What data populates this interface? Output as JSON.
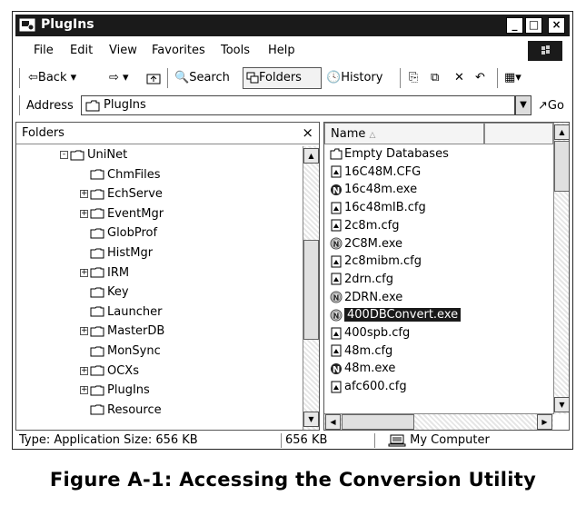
{
  "window": {
    "title": "PlugIns"
  },
  "title_buttons": {
    "minimize": "_",
    "maximize": "□",
    "close": "×"
  },
  "menu": [
    "File",
    "Edit",
    "View",
    "Favorites",
    "Tools",
    "Help"
  ],
  "toolbar": {
    "back": "Back",
    "search": "Search",
    "folders": "Folders",
    "history": "History"
  },
  "address": {
    "label": "Address",
    "value": "PlugIns",
    "go": "Go"
  },
  "folders_pane": {
    "header": "Folders",
    "close": "×",
    "items": [
      {
        "label": "UniNet",
        "expander": "-"
      },
      {
        "label": "ChmFiles",
        "expander": ""
      },
      {
        "label": "EchServe",
        "expander": "+"
      },
      {
        "label": "EventMgr",
        "expander": "+"
      },
      {
        "label": "GlobProf",
        "expander": ""
      },
      {
        "label": "HistMgr",
        "expander": ""
      },
      {
        "label": "IRM",
        "expander": "+"
      },
      {
        "label": "Key",
        "expander": ""
      },
      {
        "label": "Launcher",
        "expander": ""
      },
      {
        "label": "MasterDB",
        "expander": "+"
      },
      {
        "label": "MonSync",
        "expander": ""
      },
      {
        "label": "OCXs",
        "expander": "+"
      },
      {
        "label": "PlugIns",
        "expander": "+"
      },
      {
        "label": "Resource",
        "expander": ""
      }
    ]
  },
  "files_pane": {
    "column": "Name",
    "files": [
      {
        "name": "Empty Databases",
        "icon": "folder-icon"
      },
      {
        "name": "16C48M.CFG",
        "icon": "cfg-file-icon"
      },
      {
        "name": "16c48m.exe",
        "icon": "exe-dark-icon"
      },
      {
        "name": "16c48mIB.cfg",
        "icon": "cfg-file-icon"
      },
      {
        "name": "2c8m.cfg",
        "icon": "cfg-file-icon"
      },
      {
        "name": "2C8M.exe",
        "icon": "exe-light-icon"
      },
      {
        "name": "2c8mibm.cfg",
        "icon": "cfg-file-icon"
      },
      {
        "name": "2drn.cfg",
        "icon": "cfg-file-icon"
      },
      {
        "name": "2DRN.exe",
        "icon": "exe-light-icon"
      },
      {
        "name": "400DBConvert.exe",
        "icon": "exe-light-icon",
        "selected": true
      },
      {
        "name": "400spb.cfg",
        "icon": "cfg-file-icon"
      },
      {
        "name": "48m.cfg",
        "icon": "cfg-file-icon"
      },
      {
        "name": "48m.exe",
        "icon": "exe-dark-icon"
      },
      {
        "name": "afc600.cfg",
        "icon": "cfg-file-icon"
      }
    ]
  },
  "status": {
    "type_size": "Type: Application Size: 656 KB",
    "size": "656 KB",
    "zone": "My Computer"
  },
  "caption": "Figure A-1:  Accessing the Conversion Utility"
}
